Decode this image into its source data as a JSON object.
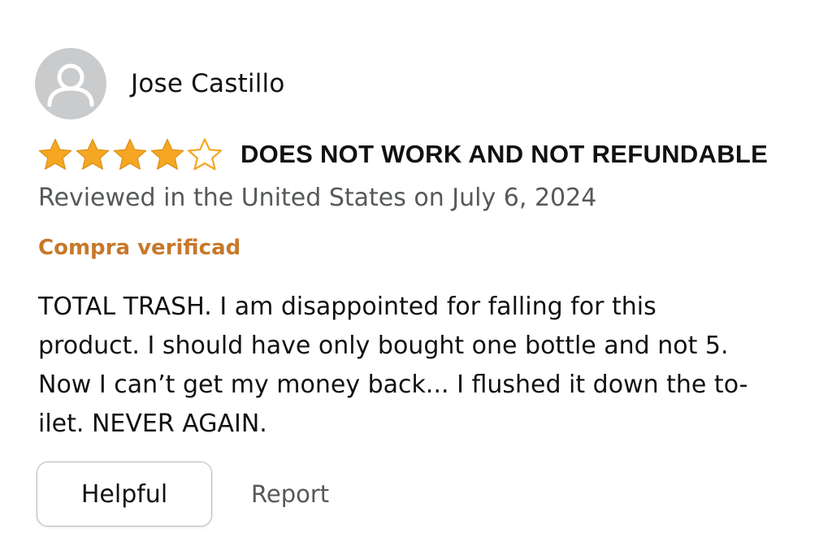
{
  "review": {
    "author_name": "Jose Castillo",
    "avatar_icon": "default-user-icon",
    "rating": 4,
    "rating_max": 5,
    "star_color": "#f5a623",
    "title": "DOES NOT WORK AND NOT REFUNDABLE",
    "date_text": "Reviewed in the United States on July 6, 2024",
    "verified_label": "Compra verificad",
    "verified_color": "#c7782a",
    "body_lines": [
      "TOTAL TRASH. I am disappointed for falling for this",
      "product. I should have only bought one bottle and not 5.",
      "Now I can’t get my money back... I flushed it down the to-",
      "ilet. NEVER AGAIN."
    ]
  },
  "actions": {
    "helpful_label": "Helpful",
    "report_label": "Report"
  }
}
